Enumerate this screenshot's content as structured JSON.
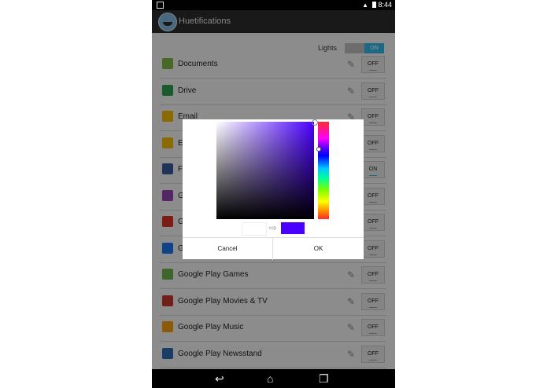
{
  "status_bar": {
    "time": "8:44"
  },
  "app": {
    "title": "Huetifications"
  },
  "lights": {
    "label": "Lights",
    "toggle": "ON"
  },
  "apps": [
    {
      "name": "Documents",
      "toggle": "OFF",
      "icon": "android-icon",
      "color": "#7cb342"
    },
    {
      "name": "Drive",
      "toggle": "OFF",
      "icon": "drive-icon",
      "color": "#2e9d4f"
    },
    {
      "name": "Email",
      "toggle": "OFF",
      "icon": "email-icon",
      "color": "#f2b705"
    },
    {
      "name": "E",
      "toggle": "OFF",
      "icon": "email-icon",
      "color": "#f2b705"
    },
    {
      "name": "F",
      "toggle": "ON",
      "icon": "facebook-icon",
      "color": "#3b5998"
    },
    {
      "name": "G",
      "toggle": "OFF",
      "icon": "gallery-icon",
      "color": "#8e44ad"
    },
    {
      "name": "G",
      "toggle": "OFF",
      "icon": "gmail-icon",
      "color": "#d93025"
    },
    {
      "name": "G",
      "toggle": "OFF",
      "icon": "books-icon",
      "color": "#1a73e8"
    },
    {
      "name": "Google Play Games",
      "toggle": "OFF",
      "icon": "gamepad-icon",
      "color": "#6ab04c"
    },
    {
      "name": "Google Play Movies & TV",
      "toggle": "OFF",
      "icon": "film-icon",
      "color": "#c0392b"
    },
    {
      "name": "Google Play Music",
      "toggle": "OFF",
      "icon": "headphones-icon",
      "color": "#f39c12"
    },
    {
      "name": "Google Play Newsstand",
      "toggle": "OFF",
      "icon": "newsstand-icon",
      "color": "#2b6cb0"
    }
  ],
  "color_picker": {
    "hue_color": "#4b00ff",
    "selected_color": "#4b00ff",
    "previous_color": "#ffffff",
    "cancel_label": "Cancel",
    "ok_label": "OK"
  }
}
